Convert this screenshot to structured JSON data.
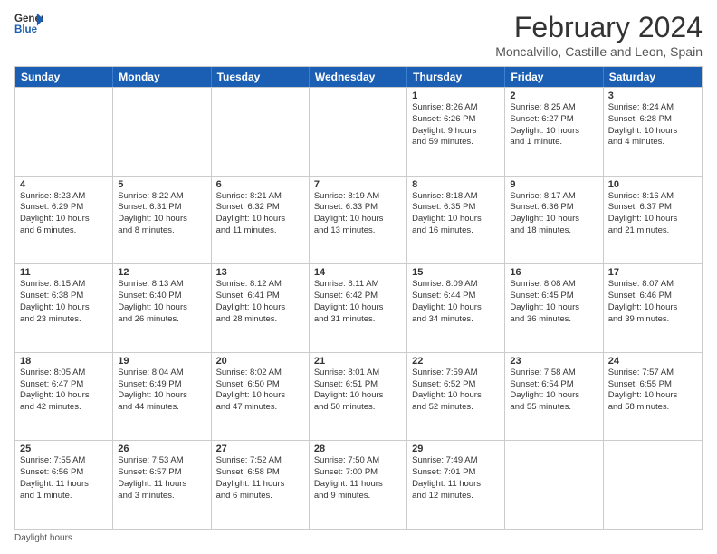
{
  "logo": {
    "line1": "General",
    "line2": "Blue"
  },
  "title": "February 2024",
  "subtitle": "Moncalvillo, Castille and Leon, Spain",
  "weekdays": [
    "Sunday",
    "Monday",
    "Tuesday",
    "Wednesday",
    "Thursday",
    "Friday",
    "Saturday"
  ],
  "footer": "Daylight hours",
  "rows": [
    [
      {
        "day": "",
        "lines": []
      },
      {
        "day": "",
        "lines": []
      },
      {
        "day": "",
        "lines": []
      },
      {
        "day": "",
        "lines": []
      },
      {
        "day": "1",
        "lines": [
          "Sunrise: 8:26 AM",
          "Sunset: 6:26 PM",
          "Daylight: 9 hours",
          "and 59 minutes."
        ]
      },
      {
        "day": "2",
        "lines": [
          "Sunrise: 8:25 AM",
          "Sunset: 6:27 PM",
          "Daylight: 10 hours",
          "and 1 minute."
        ]
      },
      {
        "day": "3",
        "lines": [
          "Sunrise: 8:24 AM",
          "Sunset: 6:28 PM",
          "Daylight: 10 hours",
          "and 4 minutes."
        ]
      }
    ],
    [
      {
        "day": "4",
        "lines": [
          "Sunrise: 8:23 AM",
          "Sunset: 6:29 PM",
          "Daylight: 10 hours",
          "and 6 minutes."
        ]
      },
      {
        "day": "5",
        "lines": [
          "Sunrise: 8:22 AM",
          "Sunset: 6:31 PM",
          "Daylight: 10 hours",
          "and 8 minutes."
        ]
      },
      {
        "day": "6",
        "lines": [
          "Sunrise: 8:21 AM",
          "Sunset: 6:32 PM",
          "Daylight: 10 hours",
          "and 11 minutes."
        ]
      },
      {
        "day": "7",
        "lines": [
          "Sunrise: 8:19 AM",
          "Sunset: 6:33 PM",
          "Daylight: 10 hours",
          "and 13 minutes."
        ]
      },
      {
        "day": "8",
        "lines": [
          "Sunrise: 8:18 AM",
          "Sunset: 6:35 PM",
          "Daylight: 10 hours",
          "and 16 minutes."
        ]
      },
      {
        "day": "9",
        "lines": [
          "Sunrise: 8:17 AM",
          "Sunset: 6:36 PM",
          "Daylight: 10 hours",
          "and 18 minutes."
        ]
      },
      {
        "day": "10",
        "lines": [
          "Sunrise: 8:16 AM",
          "Sunset: 6:37 PM",
          "Daylight: 10 hours",
          "and 21 minutes."
        ]
      }
    ],
    [
      {
        "day": "11",
        "lines": [
          "Sunrise: 8:15 AM",
          "Sunset: 6:38 PM",
          "Daylight: 10 hours",
          "and 23 minutes."
        ]
      },
      {
        "day": "12",
        "lines": [
          "Sunrise: 8:13 AM",
          "Sunset: 6:40 PM",
          "Daylight: 10 hours",
          "and 26 minutes."
        ]
      },
      {
        "day": "13",
        "lines": [
          "Sunrise: 8:12 AM",
          "Sunset: 6:41 PM",
          "Daylight: 10 hours",
          "and 28 minutes."
        ]
      },
      {
        "day": "14",
        "lines": [
          "Sunrise: 8:11 AM",
          "Sunset: 6:42 PM",
          "Daylight: 10 hours",
          "and 31 minutes."
        ]
      },
      {
        "day": "15",
        "lines": [
          "Sunrise: 8:09 AM",
          "Sunset: 6:44 PM",
          "Daylight: 10 hours",
          "and 34 minutes."
        ]
      },
      {
        "day": "16",
        "lines": [
          "Sunrise: 8:08 AM",
          "Sunset: 6:45 PM",
          "Daylight: 10 hours",
          "and 36 minutes."
        ]
      },
      {
        "day": "17",
        "lines": [
          "Sunrise: 8:07 AM",
          "Sunset: 6:46 PM",
          "Daylight: 10 hours",
          "and 39 minutes."
        ]
      }
    ],
    [
      {
        "day": "18",
        "lines": [
          "Sunrise: 8:05 AM",
          "Sunset: 6:47 PM",
          "Daylight: 10 hours",
          "and 42 minutes."
        ]
      },
      {
        "day": "19",
        "lines": [
          "Sunrise: 8:04 AM",
          "Sunset: 6:49 PM",
          "Daylight: 10 hours",
          "and 44 minutes."
        ]
      },
      {
        "day": "20",
        "lines": [
          "Sunrise: 8:02 AM",
          "Sunset: 6:50 PM",
          "Daylight: 10 hours",
          "and 47 minutes."
        ]
      },
      {
        "day": "21",
        "lines": [
          "Sunrise: 8:01 AM",
          "Sunset: 6:51 PM",
          "Daylight: 10 hours",
          "and 50 minutes."
        ]
      },
      {
        "day": "22",
        "lines": [
          "Sunrise: 7:59 AM",
          "Sunset: 6:52 PM",
          "Daylight: 10 hours",
          "and 52 minutes."
        ]
      },
      {
        "day": "23",
        "lines": [
          "Sunrise: 7:58 AM",
          "Sunset: 6:54 PM",
          "Daylight: 10 hours",
          "and 55 minutes."
        ]
      },
      {
        "day": "24",
        "lines": [
          "Sunrise: 7:57 AM",
          "Sunset: 6:55 PM",
          "Daylight: 10 hours",
          "and 58 minutes."
        ]
      }
    ],
    [
      {
        "day": "25",
        "lines": [
          "Sunrise: 7:55 AM",
          "Sunset: 6:56 PM",
          "Daylight: 11 hours",
          "and 1 minute."
        ]
      },
      {
        "day": "26",
        "lines": [
          "Sunrise: 7:53 AM",
          "Sunset: 6:57 PM",
          "Daylight: 11 hours",
          "and 3 minutes."
        ]
      },
      {
        "day": "27",
        "lines": [
          "Sunrise: 7:52 AM",
          "Sunset: 6:58 PM",
          "Daylight: 11 hours",
          "and 6 minutes."
        ]
      },
      {
        "day": "28",
        "lines": [
          "Sunrise: 7:50 AM",
          "Sunset: 7:00 PM",
          "Daylight: 11 hours",
          "and 9 minutes."
        ]
      },
      {
        "day": "29",
        "lines": [
          "Sunrise: 7:49 AM",
          "Sunset: 7:01 PM",
          "Daylight: 11 hours",
          "and 12 minutes."
        ]
      },
      {
        "day": "",
        "lines": []
      },
      {
        "day": "",
        "lines": []
      }
    ]
  ]
}
